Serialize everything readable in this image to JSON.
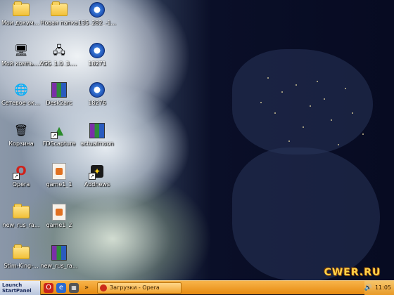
{
  "desktop": {
    "icons": [
      {
        "label": "Мои документы",
        "icon": "folder-icon"
      },
      {
        "label": "Новая папка",
        "icon": "folder-icon"
      },
      {
        "label": "135_282_-1...",
        "icon": "media-file-icon"
      },
      {
        "label": "Мой компьютер",
        "icon": "computer-icon"
      },
      {
        "label": "AGS_1.0_3.4P1...",
        "icon": "network-icon"
      },
      {
        "label": "18271",
        "icon": "media-file-icon"
      },
      {
        "label": "Сетевое окружение",
        "icon": "network-places-icon"
      },
      {
        "label": "Desk2arc",
        "icon": "winrar-icon"
      },
      {
        "label": "18276",
        "icon": "media-file-icon"
      },
      {
        "label": "Корзина",
        "icon": "recycle-bin-icon"
      },
      {
        "label": "FDScapture",
        "icon": "capture-icon"
      },
      {
        "label": "actualmoon",
        "icon": "winrar-icon"
      },
      {
        "label": "Opera",
        "icon": "opera-icon"
      },
      {
        "label": "game1_1",
        "icon": "doc-icon"
      },
      {
        "label": "Addnews",
        "icon": "addnews-icon"
      },
      {
        "label": "new_rus_ra...",
        "icon": "folder-icon"
      },
      {
        "label": "game1_2",
        "icon": "doc-icon"
      },
      {
        "label": "Stim-King-...",
        "icon": "folder-icon"
      },
      {
        "label": "new_rus_ra...",
        "icon": "winrar-icon"
      }
    ]
  },
  "taskbar": {
    "start_label": "Launch StartPanel",
    "quicklaunch": [
      "opera-icon",
      "ie-icon",
      "calculator-icon"
    ],
    "chevron": "»",
    "task_label": "Загрузки - Opera",
    "tray_time": "11:05"
  },
  "watermark": "CWER.RU"
}
